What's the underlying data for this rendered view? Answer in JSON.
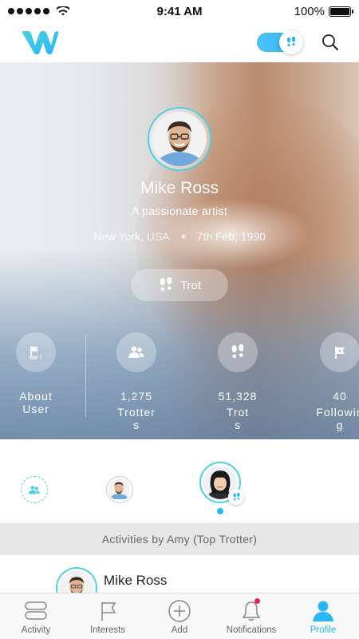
{
  "status_bar": {
    "time": "9:41 AM",
    "battery": "100%"
  },
  "profile": {
    "name": "Mike Ross",
    "tagline": "A passionate artist",
    "location": "New York, USA",
    "birthdate": "7th Feb, 1990",
    "trot_label": "Trot"
  },
  "stats": {
    "about": {
      "label": "About\nUser",
      "icon": "flag-info-icon"
    },
    "trotters": {
      "value": "1,275",
      "label": "Trotter\ns",
      "icon": "people-icon"
    },
    "trots": {
      "value": "51,328",
      "label": "Trot\ns",
      "icon": "footsteps-icon"
    },
    "following": {
      "value": "40",
      "label": "Followin\ng",
      "icon": "flag-icon"
    }
  },
  "activities": {
    "header": "Activities by Amy (Top Trotter)",
    "items": [
      {
        "name": "Mike Ross"
      }
    ]
  },
  "tabs": [
    {
      "label": "Activity",
      "icon": "activity-icon",
      "active": false
    },
    {
      "label": "Interests",
      "icon": "flag-icon",
      "active": false
    },
    {
      "label": "Add",
      "icon": "add-icon",
      "active": false
    },
    {
      "label": "Notifications",
      "icon": "bell-icon",
      "active": false
    },
    {
      "label": "Profile",
      "icon": "profile-icon",
      "active": true
    }
  ],
  "colors": {
    "accent": "#29b6f6",
    "ring": "#4dd0e1",
    "notification": "#e91e63"
  }
}
